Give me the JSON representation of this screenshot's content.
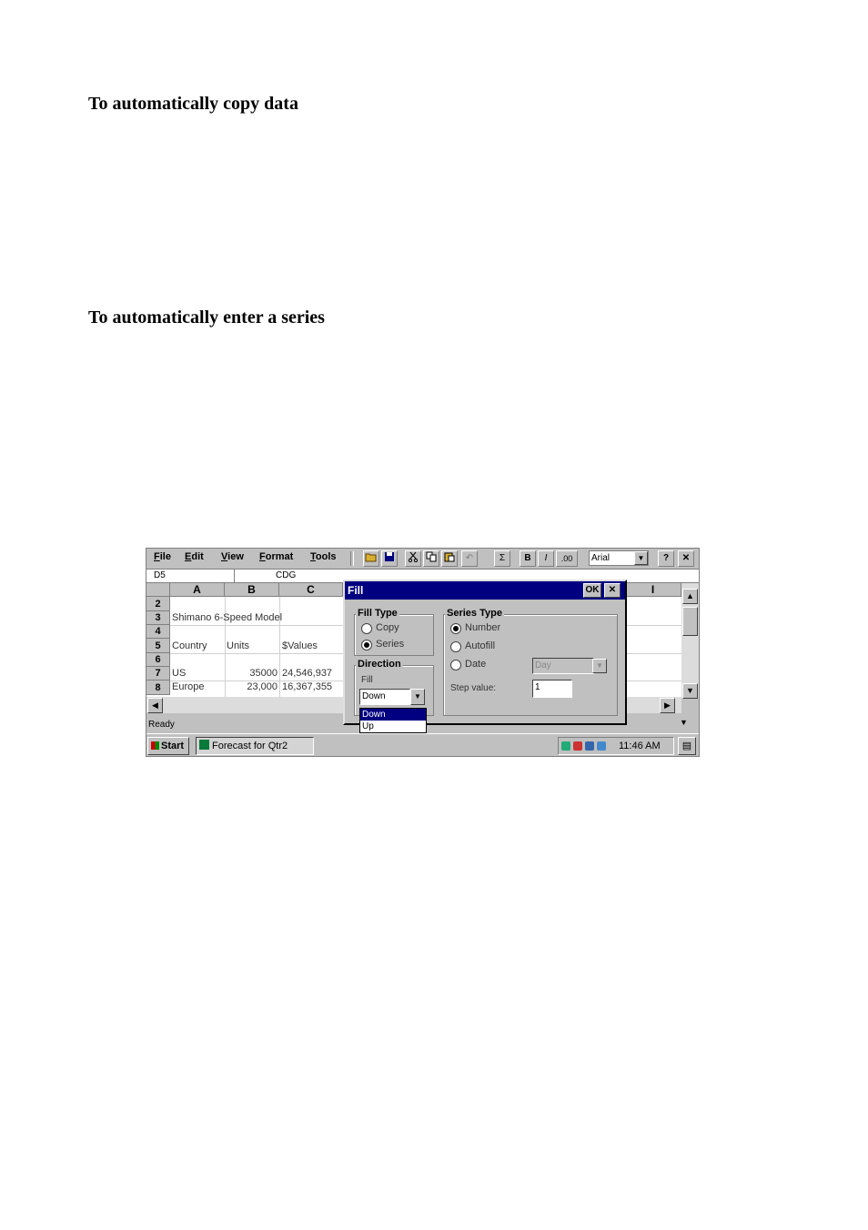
{
  "doc": {
    "heading1": "To automatically copy data",
    "heading2": "To automatically enter a series"
  },
  "app": {
    "menu": [
      "File",
      "Edit",
      "View",
      "Format",
      "Tools"
    ],
    "toolbar_glyphs": [
      "Σ",
      "B",
      "I",
      ".00"
    ],
    "font_name": "Arial",
    "help_label": "?",
    "close_label": "✕",
    "cell_ref": "D5",
    "formula": "CDG",
    "columns": [
      "A",
      "B",
      "C",
      "I"
    ],
    "rows": [
      "2",
      "3",
      "4",
      "5",
      "6",
      "7",
      "8"
    ],
    "cells": {
      "a3": "Shimano 6-Speed Model",
      "a5": "Country",
      "b5": "Units",
      "c5": "$Values",
      "a7": "US",
      "b7": "35000",
      "c7": "24,546,937",
      "a8": "Europe",
      "b8": "23,000",
      "c8": "16,367,355"
    },
    "status": "Ready"
  },
  "dialog": {
    "title": "Fill",
    "ok_label": "OK",
    "close_label": "✕",
    "fill_type": {
      "title": "Fill Type",
      "copy_label": "Copy",
      "series_label": "Series"
    },
    "direction": {
      "title": "Direction",
      "fill_label": "Fill",
      "value": "Down",
      "options": [
        "Down",
        "Up"
      ]
    },
    "series_type": {
      "title": "Series Type",
      "number_label": "Number",
      "autofill_label": "Autofill",
      "date_label": "Date",
      "date_unit": "Day",
      "step_label": "Step value:",
      "step_value": "1"
    }
  },
  "taskbar": {
    "start_label": "Start",
    "task_label": "Forecast for Qtr2",
    "clock": "11:46 AM"
  }
}
